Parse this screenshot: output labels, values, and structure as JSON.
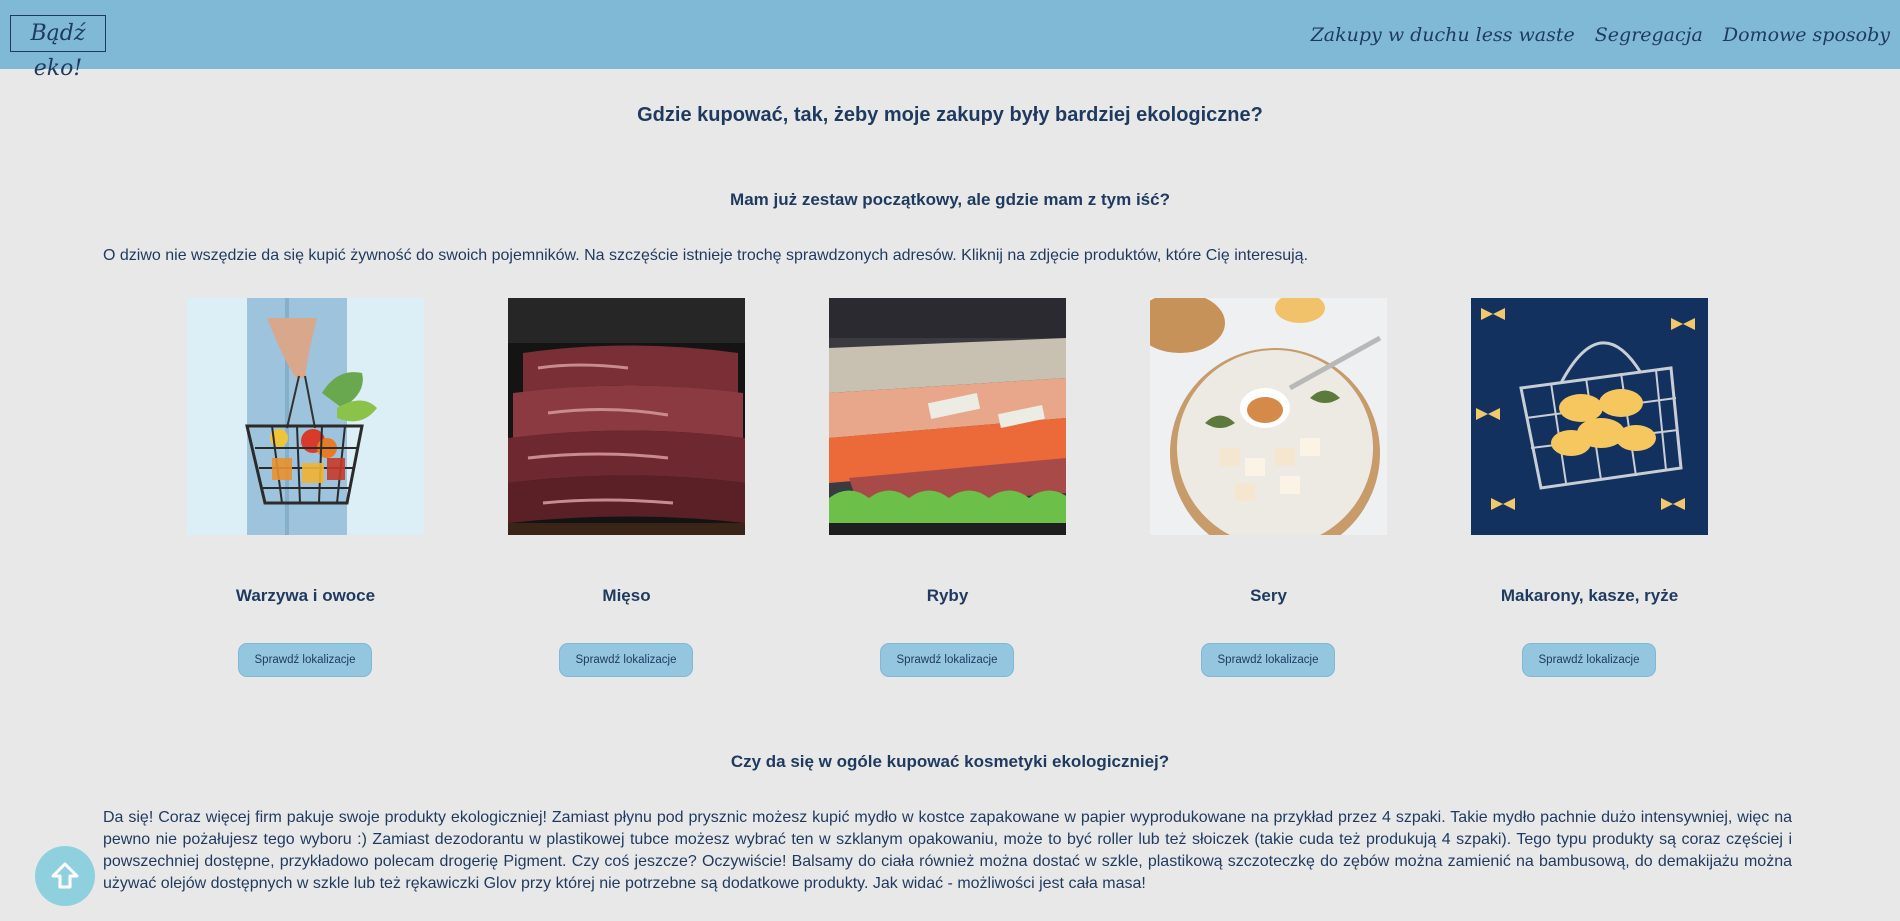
{
  "header": {
    "logo": "Bądź eko!",
    "nav": [
      {
        "label": "Zakupy w duchu less waste"
      },
      {
        "label": "Segregacja"
      },
      {
        "label": "Domowe sposoby"
      }
    ]
  },
  "main": {
    "title": "Gdzie kupować, tak, żeby moje zakupy były bardziej ekologiczne?",
    "section1": {
      "heading": "Mam już zestaw początkowy, ale gdzie mam z tym iść?",
      "intro": "O dziwo nie wszędzie da się kupić żywność do swoich pojemników. Na szczęście istnieje trochę sprawdzonych adresów. Kliknij na zdjęcie produktów, które Cię interesują."
    },
    "products": [
      {
        "title": "Warzywa i owoce",
        "button": "Sprawdź lokalizacje",
        "image": "vegetables-basket"
      },
      {
        "title": "Mięso",
        "button": "Sprawdź lokalizacje",
        "image": "meat"
      },
      {
        "title": "Ryby",
        "button": "Sprawdź lokalizacje",
        "image": "fish"
      },
      {
        "title": "Sery",
        "button": "Sprawdź lokalizacje",
        "image": "cheese"
      },
      {
        "title": "Makarony, kasze, ryże",
        "button": "Sprawdź lokalizacje",
        "image": "pasta-basket"
      }
    ],
    "section2": {
      "heading": "Czy da się w ogóle kupować kosmetyki ekologiczniej?",
      "text": "Da się! Coraz więcej firm pakuje swoje produkty ekologiczniej! Zamiast płynu pod prysznic możesz kupić mydło w kostce zapakowane w papier wyprodukowane na przykład przez 4 szpaki. Takie mydło pachnie dużo intensywniej, więc na pewno nie pożałujesz tego wyboru :) Zamiast dezodorantu w plastikowej tubce możesz wybrać ten w szklanym opakowaniu, może to być roller lub też słoiczek (takie cuda też produkują 4 szpaki). Tego typu produkty są coraz częściej i powszechniej dostępne, przykładowo polecam drogerię Pigment. Czy coś jeszcze? Oczywiście! Balsamy do ciała również można dostać w szkle, plastikową szczoteczkę do zębów można zamienić na bambusową, do demakijażu można używać olejów dostępnych w szkle lub też rękawiczki Glov przy której nie potrzebne są dodatkowe produkty. Jak widać - możliwości jest cała masa!"
    }
  },
  "scroll_top": {
    "icon": "arrow-up-icon"
  },
  "colors": {
    "header": "#7fb9d6",
    "background": "#e8e8e8",
    "text": "#1f3a5f",
    "button": "#94c6df",
    "scroll": "#8fd0df"
  }
}
